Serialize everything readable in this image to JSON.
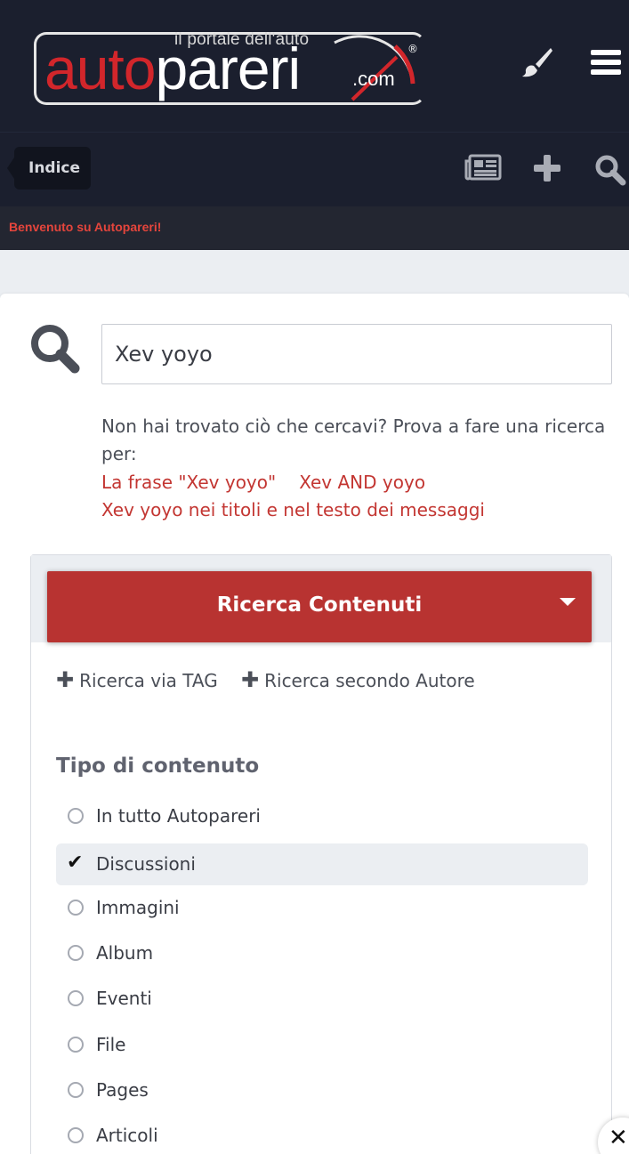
{
  "header": {
    "logo": {
      "tagline": "il portale dell'auto",
      "word_red": "auto",
      "word_white": "pareri",
      "suffix": ".com",
      "reg": "®"
    },
    "icons": [
      "paintbrush-icon",
      "menu-icon"
    ]
  },
  "nav": {
    "tab_label": "Indice",
    "icons": [
      "newspaper-icon",
      "plus-icon",
      "search-icon"
    ]
  },
  "announcement": {
    "text": "Benvenuto su Autopareri!"
  },
  "search": {
    "query": "Xev yoyo",
    "hint": "Non hai trovato ciò che cercavi? Prova a fare una ricerca per:",
    "links": {
      "phrase": "La frase \"Xev yoyo\"",
      "and": "Xev AND yoyo",
      "titles": "Xev yoyo nei titoli e nel testo dei messaggi"
    }
  },
  "filters": {
    "button_label": "Ricerca Contenuti",
    "extra_tag": "Ricerca via TAG",
    "extra_author": "Ricerca secondo Autore",
    "content_type_title": "Tipo di contenuto",
    "options": [
      {
        "label": "In tutto Autopareri",
        "selected": false
      },
      {
        "label": "Discussioni",
        "selected": true
      },
      {
        "label": "Immagini",
        "selected": false
      },
      {
        "label": "Album",
        "selected": false
      },
      {
        "label": "Eventi",
        "selected": false
      },
      {
        "label": "File",
        "selected": false
      },
      {
        "label": "Pages",
        "selected": false
      },
      {
        "label": "Articoli",
        "selected": false
      }
    ]
  },
  "colors": {
    "header_bg": "#1b1f2e",
    "accent_red": "#b83331",
    "link_red": "#c33632",
    "announce_red": "#e5453c"
  }
}
